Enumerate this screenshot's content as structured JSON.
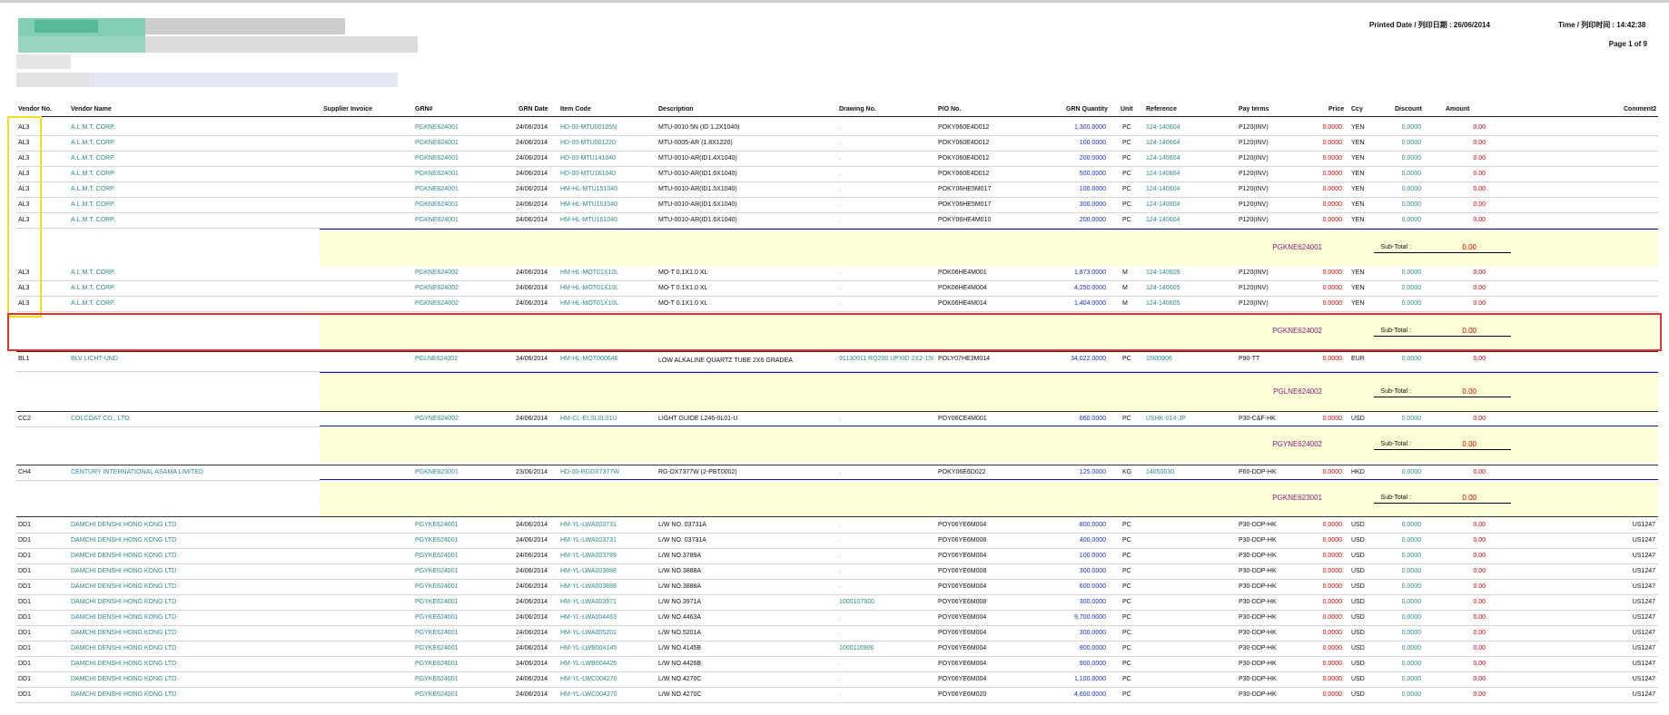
{
  "header": {
    "printed_date": "Printed Date / 列印日期 : 26/06/2014",
    "time": "Time / 列印时间 : 14:42:38",
    "page": "Page 1 of 9"
  },
  "colors": {
    "teal": "#2f8a8a",
    "blue": "#1a2fd0",
    "red": "#e00000",
    "subtotal_bg": "#fdfdd6",
    "highlight_yellow": "#f0e020",
    "highlight_red": "#e83030"
  },
  "columns": [
    "Vendor No.",
    "Vendor Name",
    "Supplier Invoice",
    "GRN#",
    "GRN Date",
    "Item Code",
    "Description",
    "Drawing No.",
    "P/O No.",
    "GRN Quantity",
    "Unit",
    "Reference",
    "Pay terms",
    "Price",
    "Ccy",
    "Discount",
    "Amount",
    "Comment2"
  ],
  "rows": [
    {
      "v": "AL3",
      "name": "A.L.M.T. CORP.",
      "grn": "PGKNE624001",
      "date": "24/06/2014",
      "item": "HD-00-MTU00105N",
      "desc": "MTU-0010 5N (ID 1.2X1040)",
      "draw": ".",
      "po": "POKY060E4D012",
      "qty": "1,300.0000",
      "unit": "PC",
      "ref": "124-140604",
      "pay": "P120(INV)",
      "price": "0.0000",
      "ccy": "YEN",
      "disc": "0.0000",
      "amt": "0.00",
      "c2": ""
    },
    {
      "v": "AL3",
      "name": "A.L.M.T. CORP.",
      "grn": "PGKNE624001",
      "date": "24/06/2014",
      "item": "HD-00-MTU001220",
      "desc": "MTU-0005-AR (1.8X1220)",
      "draw": ".",
      "po": "POKY060E4D012",
      "qty": "100.0000",
      "unit": "PC",
      "ref": "124-140604",
      "pay": "P120(INV)",
      "price": "0.0000",
      "ccy": "YEN",
      "disc": "0.0000",
      "amt": "0.00",
      "c2": ""
    },
    {
      "v": "AL3",
      "name": "A.L.M.T. CORP.",
      "grn": "PGKNE624001",
      "date": "24/06/2014",
      "item": "HD-00-MTU141040",
      "desc": "MTU-0010-AR(ID1.4X1040)",
      "draw": ".",
      "po": "POKY060E4D012",
      "qty": "200.0000",
      "unit": "PC",
      "ref": "124-140604",
      "pay": "P120(INV)",
      "price": "0.0000",
      "ccy": "YEN",
      "disc": "0.0000",
      "amt": "0.00",
      "c2": ""
    },
    {
      "v": "AL3",
      "name": "A.L.M.T. CORP.",
      "grn": "PGKNE624001",
      "date": "24/06/2014",
      "item": "HD-00-MTU161040",
      "desc": "MTU-0010-AR(ID1.6X1040)",
      "draw": ".",
      "po": "POKY060E4D012",
      "qty": "500.0000",
      "unit": "PC",
      "ref": "124-140604",
      "pay": "P120(INV)",
      "price": "0.0000",
      "ccy": "YEN",
      "disc": "0.0000",
      "amt": "0.00",
      "c2": ""
    },
    {
      "v": "AL3",
      "name": "A.L.M.T. CORP.",
      "grn": "PGKNE624001",
      "date": "24/06/2014",
      "item": "HM-HL-MTU151040",
      "desc": "MTU-0010-AR(ID1.5X1040)",
      "draw": ".",
      "po": "POKY06HE5M017",
      "qty": "100.0000",
      "unit": "PC",
      "ref": "124-140604",
      "pay": "P120(INV)",
      "price": "0.0000",
      "ccy": "YEN",
      "disc": "0.0000",
      "amt": "0.00",
      "c2": ""
    },
    {
      "v": "AL3",
      "name": "A.L.M.T. CORP.",
      "grn": "PGKNE624001",
      "date": "24/06/2014",
      "item": "HM-HL-MTU161040",
      "desc": "MTU-0010-AR(ID1.6X1040)",
      "draw": ".",
      "po": "POKY06HE5M017",
      "qty": "300.0000",
      "unit": "PC",
      "ref": "124-140604",
      "pay": "P120(INV)",
      "price": "0.0000",
      "ccy": "YEN",
      "disc": "0.0000",
      "amt": "0.00",
      "c2": ""
    },
    {
      "v": "AL3",
      "name": "A.L.M.T. CORP.",
      "grn": "PGKNE624001",
      "date": "24/06/2014",
      "item": "HM-HL-MTU161040",
      "desc": "MTU-0010-AR(ID1.6X1040)",
      "draw": ".",
      "po": "POKY06HE4M010",
      "qty": "200.0000",
      "unit": "PC",
      "ref": "124-140604",
      "pay": "P120(INV)",
      "price": "0.0000",
      "ccy": "YEN",
      "disc": "0.0000",
      "amt": "0.00",
      "c2": ""
    },
    {
      "v": "AL3",
      "name": "A.L.M.T. CORP.",
      "grn": "PGKNE624002",
      "date": "24/06/2014",
      "item": "HM-HL-MOT01X10L",
      "desc": "MO-T 0.1X1.0 XL",
      "draw": ".",
      "po": "POK06HE4M001",
      "qty": "1,873.0000",
      "unit": "M",
      "ref": "124-140605",
      "pay": "P120(INV)",
      "price": "0.0000",
      "ccy": "YEN",
      "disc": "0.0000",
      "amt": "0.00",
      "c2": ""
    },
    {
      "v": "AL3",
      "name": "A.L.M.T. CORP.",
      "grn": "PGKNE624002",
      "date": "24/06/2014",
      "item": "HM-HL-MOT01X10L",
      "desc": "MO-T 0.1X1.0 XL",
      "draw": ".",
      "po": "POK06HE4M004",
      "qty": "4,250.0000",
      "unit": "M",
      "ref": "124-140605",
      "pay": "P120(INV)",
      "price": "0.0000",
      "ccy": "YEN",
      "disc": "0.0000",
      "amt": "0.00",
      "c2": ""
    },
    {
      "v": "AL3",
      "name": "A.L.M.T. CORP.",
      "grn": "PGKNE624002",
      "date": "24/06/2014",
      "item": "HM-HL-MOT01X10L",
      "desc": "MO-T 0.1X1.0 XL",
      "draw": ".",
      "po": "POK06HE4M014",
      "qty": "1,404.0000",
      "unit": "M",
      "ref": "124-140605",
      "pay": "P120(INV)",
      "price": "0.0000",
      "ccy": "YEN",
      "disc": "0.0000",
      "amt": "0.00",
      "c2": ""
    },
    {
      "v": "BL1",
      "name": "BLV LICHT-UND",
      "grn": "PGLNE624002",
      "date": "24/06/2014",
      "item": "HM-HL-MOT000646",
      "desc": "LOW ALKALINE QUARTZ TUBE 2X6 GRADEA",
      "draw": "91130011 RQ200 UPXID 2X2-15C",
      "po": "POLY07HE3M014",
      "qty": "34,022.0000",
      "unit": "PC",
      "ref": "15l00906",
      "pay": "P90-TT",
      "price": "0.0000",
      "ccy": "EUR",
      "disc": "0.0000",
      "amt": "0.00",
      "c2": ""
    },
    {
      "v": "CC2",
      "name": "COLCOAT CO., LTD.",
      "grn": "PGYNE624002",
      "date": "24/06/2014",
      "item": "HM-CL-ELSL0L01U",
      "desc": "LIGHT GUIDE L246-0L01-U",
      "draw": ".",
      "po": "POY06CE4M001",
      "qty": "660.0000",
      "unit": "PC",
      "ref": "USHK-014-JP",
      "pay": "P30-C&F-HK",
      "price": "0.0000",
      "ccy": "USD",
      "disc": "0.0000",
      "amt": "0.00",
      "c2": ""
    },
    {
      "v": "CH4",
      "name": "CENTURY INTERNATIONAL ASAMA LIMITED",
      "grn": "PGKNE623001",
      "date": "23/06/2014",
      "item": "HD-00-RGDX7377W",
      "desc": "RG-DX7377W (2-PBT0002)",
      "draw": ".",
      "po": "POKY06E6D022",
      "qty": "125.0000",
      "unit": "KG",
      "ref": "14050030",
      "pay": "P60-DDP-HK",
      "price": "0.0000",
      "ccy": "HKD",
      "disc": "0.0000",
      "amt": "0.00",
      "c2": ""
    },
    {
      "v": "DD1",
      "name": "DAMCHI DENSHI HONG KONG LTD",
      "grn": "PGYKE624001",
      "date": "24/06/2014",
      "item": "HM-YL-LWA003731",
      "desc": "L/W NO. 03731A",
      "draw": ".",
      "po": "POY06YE6M004",
      "qty": "800.0000",
      "unit": "PC",
      "ref": "",
      "pay": "P30-DDP-HK",
      "price": "0.0000",
      "ccy": "USD",
      "disc": "0.0000",
      "amt": "0.00",
      "c2": "US1247"
    },
    {
      "v": "DD1",
      "name": "DAMCHI DENSHI HONG KONG LTD",
      "grn": "PGYKE624001",
      "date": "24/06/2014",
      "item": "HM-YL-LWA003731",
      "desc": "L/W NO. 03731A",
      "draw": ".",
      "po": "POY06YE6M008",
      "qty": "400.0000",
      "unit": "PC",
      "ref": "",
      "pay": "P30-DDP-HK",
      "price": "0.0000",
      "ccy": "USD",
      "disc": "0.0000",
      "amt": "0.00",
      "c2": "US1247"
    },
    {
      "v": "DD1",
      "name": "DAMCHI DENSHI HONG KONG LTD",
      "grn": "PGYKE624001",
      "date": "24/06/2014",
      "item": "HM-YL-LWA003789",
      "desc": "L/W NO.3789A",
      "draw": ".",
      "po": "POY06YE6M004",
      "qty": "100.0000",
      "unit": "PC",
      "ref": "",
      "pay": "P30-DDP-HK",
      "price": "0.0000",
      "ccy": "USD",
      "disc": "0.0000",
      "amt": "0.00",
      "c2": "US1247"
    },
    {
      "v": "DD1",
      "name": "DAMCHI DENSHI HONG KONG LTD",
      "grn": "PGYKE624001",
      "date": "24/06/2014",
      "item": "HM-YL-LWA003888",
      "desc": "L/W NO.3888A",
      "draw": ".",
      "po": "POY06YE6M008",
      "qty": "300.0000",
      "unit": "PC",
      "ref": "",
      "pay": "P30-DDP-HK",
      "price": "0.0000",
      "ccy": "USD",
      "disc": "0.0000",
      "amt": "0.00",
      "c2": "US1247"
    },
    {
      "v": "DD1",
      "name": "DAMCHI DENSHI HONG KONG LTD",
      "grn": "PGYKE624001",
      "date": "24/06/2014",
      "item": "HM-YL-LWA003888",
      "desc": "L/W NO.3888A",
      "draw": ".",
      "po": "POY06YE6M004",
      "qty": "600.0000",
      "unit": "PC",
      "ref": "",
      "pay": "P30-DDP-HK",
      "price": "0.0000",
      "ccy": "USD",
      "disc": "0.0000",
      "amt": "0.00",
      "c2": "US1247"
    },
    {
      "v": "DD1",
      "name": "DAMCHI DENSHI HONG KONG LTD",
      "grn": "PGYKE624001",
      "date": "24/06/2014",
      "item": "HM-YL-LWA003971",
      "desc": "L/W NO.3971A",
      "draw": "1000107920",
      "po": "POY06YE6M008",
      "qty": "300.0000",
      "unit": "PC",
      "ref": "",
      "pay": "P30-DDP-HK",
      "price": "0.0000",
      "ccy": "USD",
      "disc": "0.0000",
      "amt": "0.00",
      "c2": "US1247"
    },
    {
      "v": "DD1",
      "name": "DAMCHI DENSHI HONG KONG LTD",
      "grn": "PGYKE624001",
      "date": "24/06/2014",
      "item": "HM-YL-LWA004463",
      "desc": "L/W NO.4463A",
      "draw": ".",
      "po": "POY06YE6M004",
      "qty": "9,700.0000",
      "unit": "PC",
      "ref": "",
      "pay": "P30-DDP-HK",
      "price": "0.0000",
      "ccy": "USD",
      "disc": "0.0000",
      "amt": "0.00",
      "c2": "US1247"
    },
    {
      "v": "DD1",
      "name": "DAMCHI DENSHI HONG KONG LTD",
      "grn": "PGYKE624001",
      "date": "24/06/2014",
      "item": "HM-YL-LWA005201",
      "desc": "L/W NO.5201A",
      "draw": ".",
      "po": "POY06YE6M004",
      "qty": "300.0000",
      "unit": "PC",
      "ref": "",
      "pay": "P30-DDP-HK",
      "price": "0.0000",
      "ccy": "USD",
      "disc": "0.0000",
      "amt": "0.00",
      "c2": "US1247"
    },
    {
      "v": "DD1",
      "name": "DAMCHI DENSHI HONG KONG LTD",
      "grn": "PGYKE624001",
      "date": "24/06/2014",
      "item": "HM-YL-LWB004145",
      "desc": "L/W NO.4145B",
      "draw": "1000116906",
      "po": "POY06YE6M004",
      "qty": "900.0000",
      "unit": "PC",
      "ref": "",
      "pay": "P30-DDP-HK",
      "price": "0.0000",
      "ccy": "USD",
      "disc": "0.0000",
      "amt": "0.00",
      "c2": "US1247"
    },
    {
      "v": "DD1",
      "name": "DAMCHI DENSHI HONG KONG LTD",
      "grn": "PGYKE624001",
      "date": "24/06/2014",
      "item": "HM-YL-LWB004426",
      "desc": "L/W NO.4426B",
      "draw": ".",
      "po": "POY06YE6M004",
      "qty": "900.0000",
      "unit": "PC",
      "ref": "",
      "pay": "P30-DDP-HK",
      "price": "0.0000",
      "ccy": "USD",
      "disc": "0.0000",
      "amt": "0.00",
      "c2": "US1247"
    },
    {
      "v": "DD1",
      "name": "DAMCHI DENSHI HONG KONG LTD",
      "grn": "PGYKE624001",
      "date": "24/06/2014",
      "item": "HM-YL-LWC004270",
      "desc": "L/W NO.4270C",
      "draw": ".",
      "po": "POY06YE6M004",
      "qty": "1,100.0000",
      "unit": "PC",
      "ref": "",
      "pay": "P30-DDP-HK",
      "price": "0.0000",
      "ccy": "USD",
      "disc": "0.0000",
      "amt": "0.00",
      "c2": "US1247"
    },
    {
      "v": "DD1",
      "name": "DAMCHI DENSHI HONG KONG LTD",
      "grn": "PGYKE624001",
      "date": "24/06/2014",
      "item": "HM-YL-LWC004270",
      "desc": "L/W NO.4270C",
      "draw": ".",
      "po": "POY06YE6M020",
      "qty": "4,600.0000",
      "unit": "PC",
      "ref": "",
      "pay": "P30-DDP-HK",
      "price": "0.0000",
      "ccy": "USD",
      "disc": "0.0000",
      "amt": "0.00",
      "c2": "US1247"
    }
  ],
  "subtotals": [
    {
      "grn": "PGKNE624001",
      "label": "Sub-Total :",
      "value": "0.00"
    },
    {
      "grn": "PGKNE624002",
      "label": "Sub-Total :",
      "value": "0.00"
    },
    {
      "grn": "PGLNE624002",
      "label": "Sub-Total :",
      "value": "0.00"
    },
    {
      "grn": "PGYNE624002",
      "label": "Sub-Total :",
      "value": "0.00"
    },
    {
      "grn": "PGKNE623001",
      "label": "Sub-Total :",
      "value": "0.00"
    }
  ]
}
